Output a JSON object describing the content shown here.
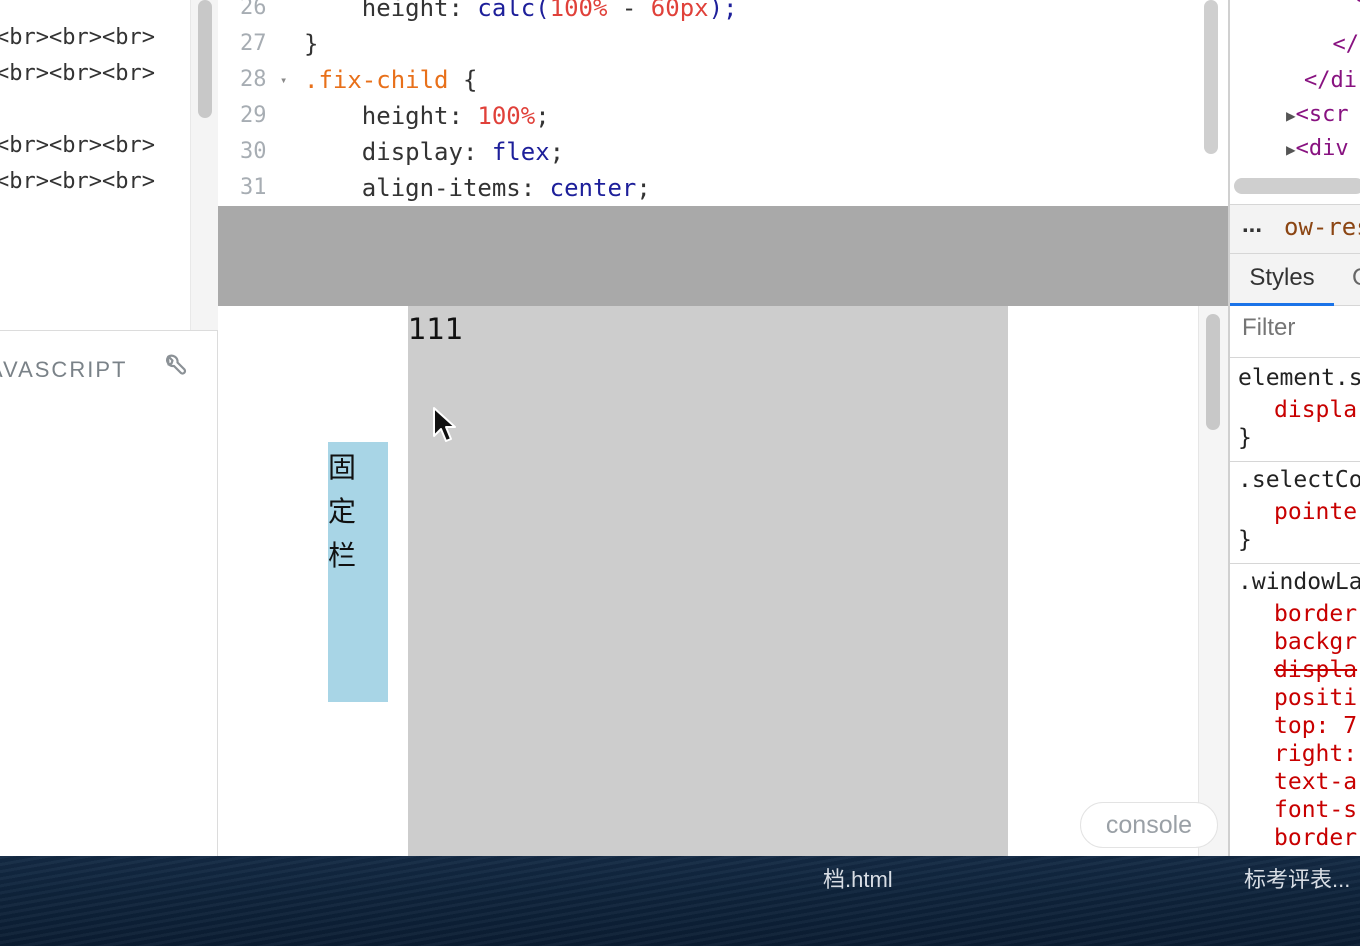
{
  "html_panel": {
    "lines": [
      "<br><br><br>",
      "<br><br><br>",
      "",
      "<br><br><br>",
      "<br><br><br>"
    ]
  },
  "js_panel": {
    "label": "AVASCRIPT",
    "icon": "wrench-icon"
  },
  "css_editor": {
    "lines": [
      {
        "num": "26",
        "text": "    height: calc(100% - 60px);"
      },
      {
        "num": "27",
        "text": "}"
      },
      {
        "num": "28",
        "text": ".fix-child {"
      },
      {
        "num": "29",
        "text": "    height: 100%;"
      },
      {
        "num": "30",
        "text": "    display: flex;"
      },
      {
        "num": "31",
        "text": "    align-items: center;"
      }
    ],
    "tokens": {
      "l26_prop": "    height: ",
      "l26_fn": "calc(",
      "l26_num1": "100%",
      "l26_op": " - ",
      "l26_num2": "60px",
      "l26_end": ");",
      "l27": "}",
      "l28_sel": ".fix-child",
      "l28_brace": " {",
      "l29_prop": "    height: ",
      "l29_num": "100%",
      "l29_end": ";",
      "l30_prop": "    display: ",
      "l30_val": "flex",
      "l30_end": ";",
      "l31_prop": "    align-items: ",
      "l31_val": "center",
      "l31_end": ";"
    },
    "fold_marker": "▾"
  },
  "result": {
    "number_text": "111",
    "fixed_bar_text": "固定栏",
    "console_button": "console"
  },
  "devtools": {
    "dom_lines": [
      "  <",
      "  </",
      "</di",
      "<scr",
      "<div"
    ],
    "breadcrumb_more": "...",
    "breadcrumb_text": "ow-resu",
    "tab_styles": "Styles",
    "tab_other": "C",
    "filter_placeholder": "Filter",
    "rules": {
      "r1_selector": "element.s",
      "r1_prop": "displa",
      "r1_close": "}",
      "r2_selector": ".selectCo",
      "r2_prop": "pointe",
      "r2_close": "}",
      "r3_selector": ".windowLa",
      "r3_props": [
        "border",
        "backgr",
        "displa",
        "positi",
        "top: 7",
        "right:",
        "text-a",
        "font-s",
        "border"
      ]
    }
  },
  "taskbar": {
    "file_title": "档.html",
    "doc_title": "标考评表..."
  },
  "colors": {
    "fixed_header": "#a9a9a9",
    "content_gray": "#cdcdcd",
    "fixed_bar": "#a8d5e6",
    "selector_orange": "#e8701a",
    "number_red": "#e0413a",
    "value_navy": "#1d1f9a",
    "devtools_prop_red": "#c80000",
    "tab_underline": "#1a73e8"
  }
}
